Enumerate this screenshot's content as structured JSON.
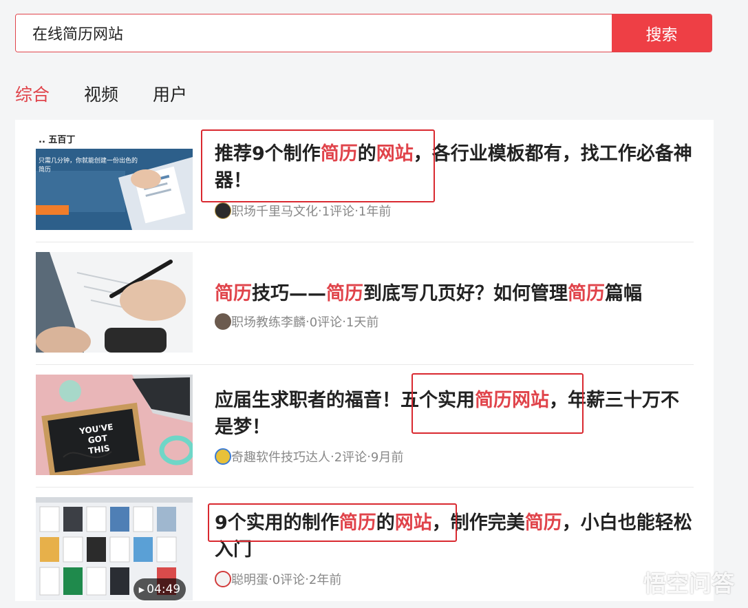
{
  "search": {
    "query": "在线简历网站",
    "button_label": "搜索"
  },
  "tabs": [
    {
      "label": "综合",
      "active": true
    },
    {
      "label": "视频",
      "active": false
    },
    {
      "label": "用户",
      "active": false
    }
  ],
  "results": [
    {
      "title_parts": [
        {
          "text": "推荐9个制作",
          "hl": false
        },
        {
          "text": "简历",
          "hl": true
        },
        {
          "text": "的",
          "hl": false
        },
        {
          "text": "网站",
          "hl": true
        },
        {
          "text": "，各行业模板都有，找工作必备神器！",
          "hl": false
        }
      ],
      "author": "职场千里马文化",
      "comments": "1评论",
      "time": "1年前",
      "thumb_text": ".. 五百丁",
      "thumb_subtext": "只需几分钟，你就能创建一份出色的简历"
    },
    {
      "title_parts": [
        {
          "text": "简历",
          "hl": true
        },
        {
          "text": "技巧——",
          "hl": false
        },
        {
          "text": "简历",
          "hl": true
        },
        {
          "text": "到底写几页好？如何管理",
          "hl": false
        },
        {
          "text": "简历",
          "hl": true
        },
        {
          "text": "篇幅",
          "hl": false
        }
      ],
      "author": "职场教练李麟",
      "comments": "0评论",
      "time": "1天前"
    },
    {
      "title_parts": [
        {
          "text": "应届生求职者的福音！五个实用",
          "hl": false
        },
        {
          "text": "简历网站",
          "hl": true
        },
        {
          "text": "，年薪三十万不是梦！",
          "hl": false
        }
      ],
      "author": "奇趣软件技巧达人",
      "comments": "2评论",
      "time": "9月前",
      "thumb_text": "YOU'VE GOT THIS"
    },
    {
      "title_parts": [
        {
          "text": "9个实用的制作",
          "hl": false
        },
        {
          "text": "简历",
          "hl": true
        },
        {
          "text": "的",
          "hl": false
        },
        {
          "text": "网站",
          "hl": true
        },
        {
          "text": "，制作完美",
          "hl": false
        },
        {
          "text": "简历",
          "hl": true
        },
        {
          "text": "，小白也能轻松入门",
          "hl": false
        }
      ],
      "author": "聪明蛋",
      "comments": "0评论",
      "time": "2年前",
      "duration": "04:49"
    }
  ],
  "meta_separator": " · ",
  "watermark": "悟空问答",
  "colors": {
    "accent": "#ee3f45",
    "highlight": "#e0434a",
    "meta": "#888888",
    "annotation_box": "#d9282f"
  }
}
